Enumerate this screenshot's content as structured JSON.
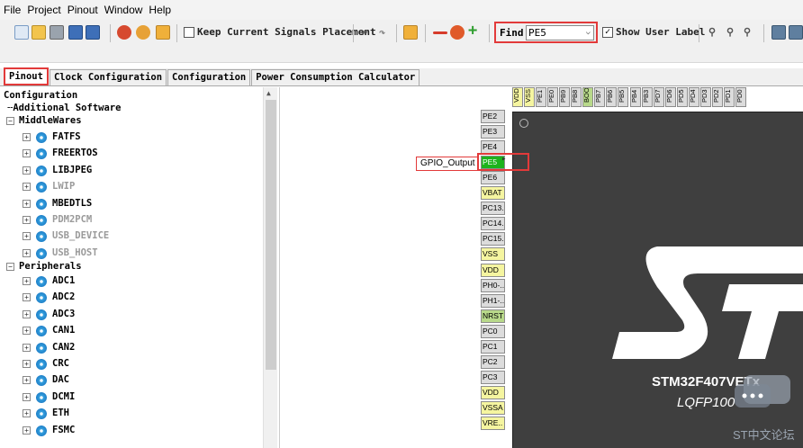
{
  "menu": [
    "File",
    "Project",
    "Pinout",
    "Window",
    "Help"
  ],
  "toolbar": {
    "keep_placement_label": "Keep Current Signals Placement",
    "keep_placement_checked": false,
    "find_label": "Find",
    "find_value": "PE5",
    "show_user_label": "Show User Label",
    "show_user_label_checked": true
  },
  "tabs": [
    "Pinout",
    "Clock Configuration",
    "Configuration",
    "Power Consumption Calculator"
  ],
  "active_tab": "Pinout",
  "tree": {
    "root": "Configuration",
    "additional": "Additional Software",
    "middlewares_label": "MiddleWares",
    "middlewares": [
      {
        "label": "FATFS",
        "enabled": true
      },
      {
        "label": "FREERTOS",
        "enabled": true
      },
      {
        "label": "LIBJPEG",
        "enabled": true
      },
      {
        "label": "LWIP",
        "enabled": false
      },
      {
        "label": "MBEDTLS",
        "enabled": true
      },
      {
        "label": "PDM2PCM",
        "enabled": false
      },
      {
        "label": "USB_DEVICE",
        "enabled": false
      },
      {
        "label": "USB_HOST",
        "enabled": false
      }
    ],
    "peripherals_label": "Peripherals",
    "peripherals": [
      "ADC1",
      "ADC2",
      "ADC3",
      "CAN1",
      "CAN2",
      "CRC",
      "DAC",
      "DCMI",
      "ETH",
      "FSMC"
    ]
  },
  "pinout": {
    "top_pins": [
      {
        "label": "VDD",
        "type": "power"
      },
      {
        "label": "VSS",
        "type": "power"
      },
      {
        "label": "PE1",
        "type": "io"
      },
      {
        "label": "PE0",
        "type": "io"
      },
      {
        "label": "PB9",
        "type": "io"
      },
      {
        "label": "PB8",
        "type": "io"
      },
      {
        "label": "BOO..",
        "type": "boot"
      },
      {
        "label": "PB7",
        "type": "io"
      },
      {
        "label": "PB6",
        "type": "io"
      },
      {
        "label": "PB5",
        "type": "io"
      },
      {
        "label": "PB4",
        "type": "io"
      },
      {
        "label": "PB3",
        "type": "io"
      },
      {
        "label": "PD7",
        "type": "io"
      },
      {
        "label": "PD6",
        "type": "io"
      },
      {
        "label": "PD5",
        "type": "io"
      },
      {
        "label": "PD4",
        "type": "io"
      },
      {
        "label": "PD3",
        "type": "io"
      },
      {
        "label": "PD2",
        "type": "io"
      },
      {
        "label": "PD1",
        "type": "io"
      },
      {
        "label": "PD0",
        "type": "io"
      }
    ],
    "left_pins": [
      {
        "label": "PE2",
        "type": "io"
      },
      {
        "label": "PE3",
        "type": "io"
      },
      {
        "label": "PE4",
        "type": "io"
      },
      {
        "label": "PE5",
        "type": "gpio"
      },
      {
        "label": "PE6",
        "type": "io"
      },
      {
        "label": "VBAT",
        "type": "power"
      },
      {
        "label": "PC13..",
        "type": "io"
      },
      {
        "label": "PC14..",
        "type": "io"
      },
      {
        "label": "PC15..",
        "type": "io"
      },
      {
        "label": "VSS",
        "type": "power"
      },
      {
        "label": "VDD",
        "type": "power"
      },
      {
        "label": "PH0-..",
        "type": "io"
      },
      {
        "label": "PH1-..",
        "type": "io"
      },
      {
        "label": "NRST",
        "type": "reset"
      },
      {
        "label": "PC0",
        "type": "io"
      },
      {
        "label": "PC1",
        "type": "io"
      },
      {
        "label": "PC2",
        "type": "io"
      },
      {
        "label": "PC3",
        "type": "io"
      },
      {
        "label": "VDD",
        "type": "power"
      },
      {
        "label": "VSSA",
        "type": "power"
      },
      {
        "label": "VRE..",
        "type": "power"
      }
    ],
    "gpio_label": "GPIO_Output",
    "part_name": "STM32F407VETx",
    "package": "LQFP100"
  },
  "watermark": "ST中文论坛",
  "colors": {
    "highlight": "#e23a3a",
    "gpio_pin": "#1cb31c",
    "power_pin": "#f5f5a0",
    "chip_body": "#3f3f3f"
  }
}
